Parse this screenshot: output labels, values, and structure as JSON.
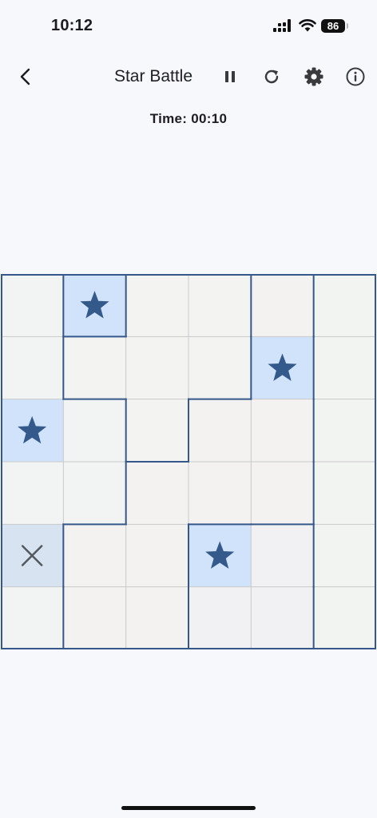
{
  "status_bar": {
    "time": "10:12",
    "battery": "86"
  },
  "nav": {
    "title": "Star Battle",
    "icons": [
      "back-chevron-icon",
      "pause-icon",
      "restart-icon",
      "settings-gear-icon",
      "info-icon"
    ]
  },
  "timer": {
    "text": "Time: 00:10"
  },
  "board": {
    "size": 6,
    "regions": [
      [
        0,
        1,
        2,
        2,
        3,
        4
      ],
      [
        0,
        2,
        2,
        2,
        3,
        4
      ],
      [
        0,
        0,
        2,
        3,
        3,
        4
      ],
      [
        0,
        0,
        3,
        3,
        3,
        4
      ],
      [
        0,
        3,
        3,
        5,
        5,
        4
      ],
      [
        0,
        3,
        3,
        5,
        5,
        4
      ]
    ],
    "region_colors": [
      "#f1f4f3",
      "#f2f2f2",
      "#f3f4f2",
      "#f4f2f0",
      "#f2f4f2",
      "#f1f1f3"
    ],
    "stars": [
      [
        0,
        1
      ],
      [
        1,
        4
      ],
      [
        2,
        0
      ],
      [
        4,
        3
      ]
    ],
    "crosses": [
      [
        4,
        0
      ]
    ],
    "star_cell_color": "#d0e3fa",
    "cross_cell_color": "#d8e3f2",
    "star_color": "#34598b",
    "cross_color": "#555a60",
    "border_color": "#35578a",
    "grid_color": "#c9c9c9"
  }
}
